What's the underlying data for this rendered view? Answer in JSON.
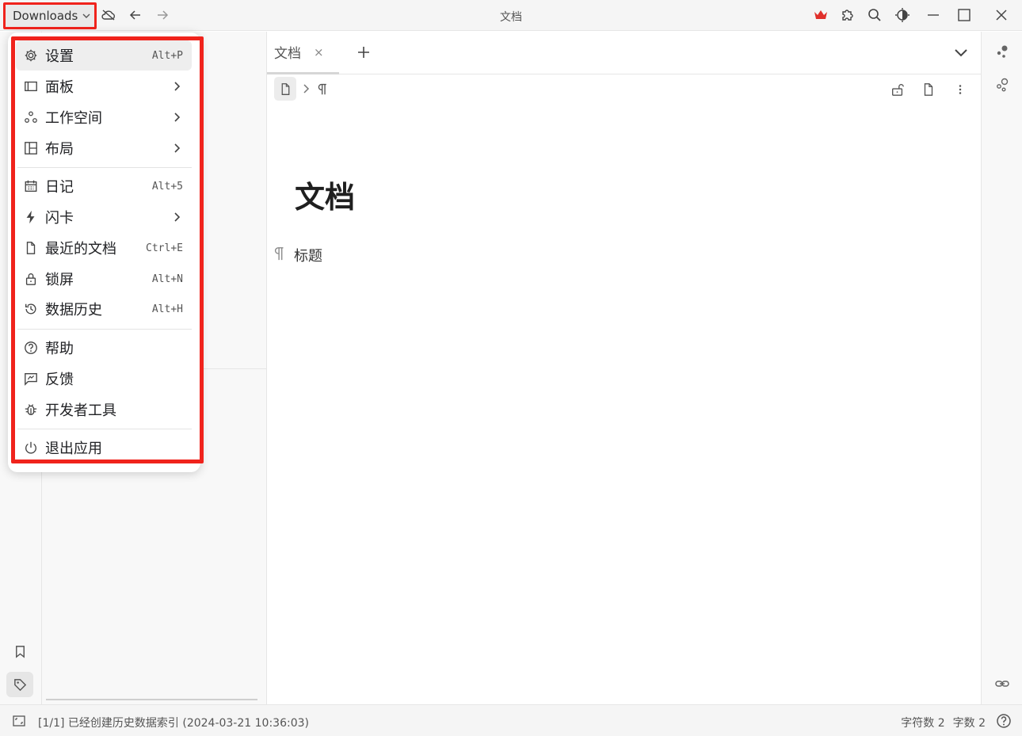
{
  "titlebar": {
    "workspace_label": "Downloads",
    "window_title": "文档",
    "icons": [
      "cloud-off-icon",
      "arrow-left-icon",
      "arrow-right-icon",
      "crown-icon",
      "puzzle-icon",
      "search-icon",
      "theme-icon",
      "minimize-icon",
      "maximize-icon",
      "close-icon"
    ],
    "crown_color": "#e0302b"
  },
  "menu": {
    "items": [
      {
        "label": "设置",
        "shortcut": "Alt+P",
        "icon": "gear-icon"
      },
      {
        "label": "面板",
        "icon": "panel-icon"
      },
      {
        "label": "工作空间",
        "icon": "workspace-icon"
      },
      {
        "label": "布局",
        "icon": "layout-icon"
      },
      {
        "label": "日记",
        "shortcut": "Alt+5",
        "icon": "calendar-icon"
      },
      {
        "label": "闪卡",
        "icon": "flash-icon"
      },
      {
        "label": "最近的文档",
        "shortcut": "Ctrl+E",
        "icon": "file-icon"
      },
      {
        "label": "锁屏",
        "shortcut": "Alt+N",
        "icon": "lock-icon"
      },
      {
        "label": "数据历史",
        "shortcut": "Alt+H",
        "icon": "history-icon"
      },
      {
        "label": "帮助",
        "icon": "help-icon"
      },
      {
        "label": "反馈",
        "icon": "feedback-icon"
      },
      {
        "label": "开发者工具",
        "icon": "bug-icon"
      },
      {
        "label": "退出应用",
        "icon": "power-icon"
      }
    ],
    "highlight_color": "#f0231c"
  },
  "editor": {
    "tab_label": "文档",
    "tab_close": "×",
    "doc_title": "文档",
    "paragraph": "标题"
  },
  "status": {
    "message": "[1/1] 已经创建历史数据索引 (2024-03-21 10:36:03)",
    "char_count": "字符数 2",
    "word_count": "字数 2"
  }
}
